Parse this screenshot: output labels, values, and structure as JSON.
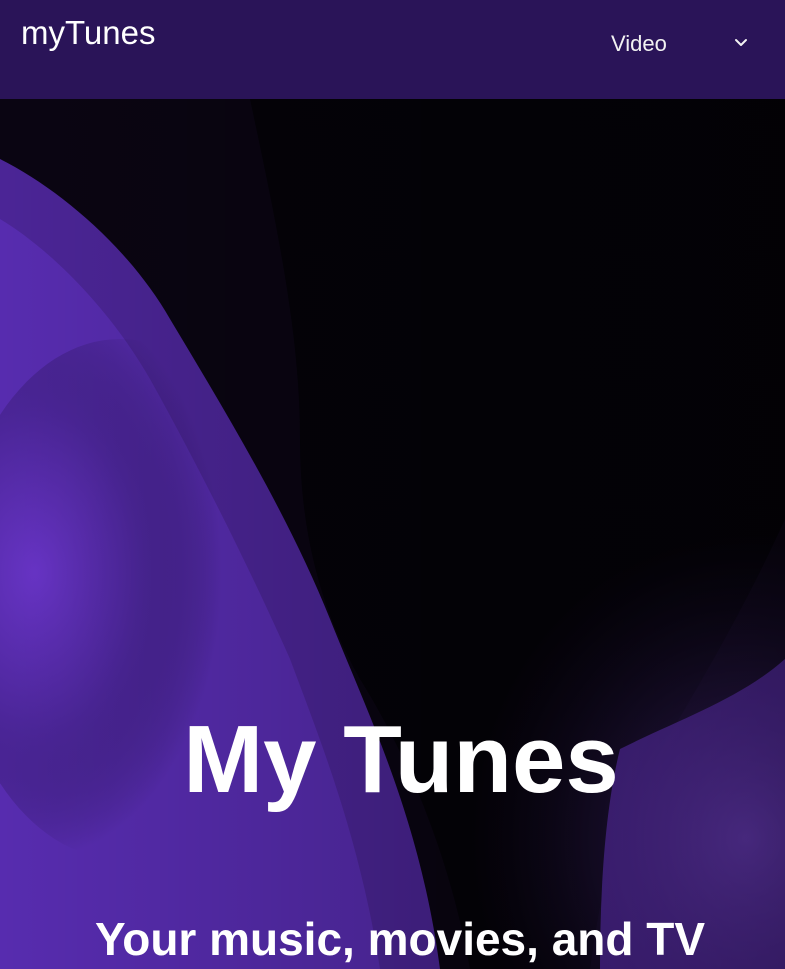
{
  "navbar": {
    "brand": "myTunes",
    "dropdown_label": "Video",
    "dropdown_icon": "chevron-down-icon"
  },
  "hero": {
    "title": "My Tunes",
    "subtitle": "Your music, movies, and TV shows take center stage."
  },
  "colors": {
    "navbar_bg": "#2a1458",
    "hero_accent": "#5a2cb0",
    "text": "#ffffff"
  }
}
